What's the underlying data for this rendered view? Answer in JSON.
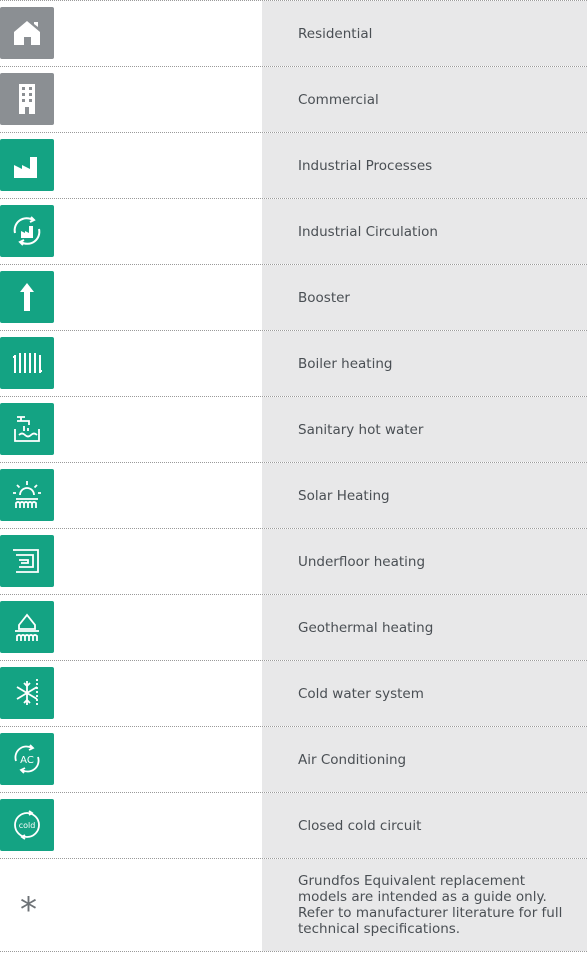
{
  "colors": {
    "grey_icon": "#8b8f93",
    "green_icon": "#14a383",
    "label_bg": "#e8e8e9",
    "label_text": "#4a4f54"
  },
  "rows": [
    {
      "icon": "residential-house-icon",
      "label": "Residential"
    },
    {
      "icon": "commercial-building-icon",
      "label": "Commercial"
    },
    {
      "icon": "industrial-factory-icon",
      "label": "Industrial Processes"
    },
    {
      "icon": "industrial-circulation-icon",
      "label": "Industrial Circulation"
    },
    {
      "icon": "booster-arrow-icon",
      "label": "Booster"
    },
    {
      "icon": "boiler-radiator-icon",
      "label": "Boiler heating"
    },
    {
      "icon": "sanitary-hot-water-icon",
      "label": "Sanitary hot water"
    },
    {
      "icon": "solar-heating-icon",
      "label": "Solar Heating"
    },
    {
      "icon": "underfloor-heating-icon",
      "label": "Underfloor heating"
    },
    {
      "icon": "geothermal-heating-icon",
      "label": "Geothermal heating"
    },
    {
      "icon": "cold-water-snowflake-icon",
      "label": "Cold water system"
    },
    {
      "icon": "air-conditioning-icon",
      "label": "Air Conditioning",
      "icon_text": "AC"
    },
    {
      "icon": "closed-cold-circuit-icon",
      "label": "Closed cold circuit",
      "icon_text": "cold"
    }
  ],
  "note": {
    "symbol": "*",
    "text": "Grundfos Equivalent replacement models are intended as a guide only. Refer to manufacturer literature for full technical specifications."
  }
}
